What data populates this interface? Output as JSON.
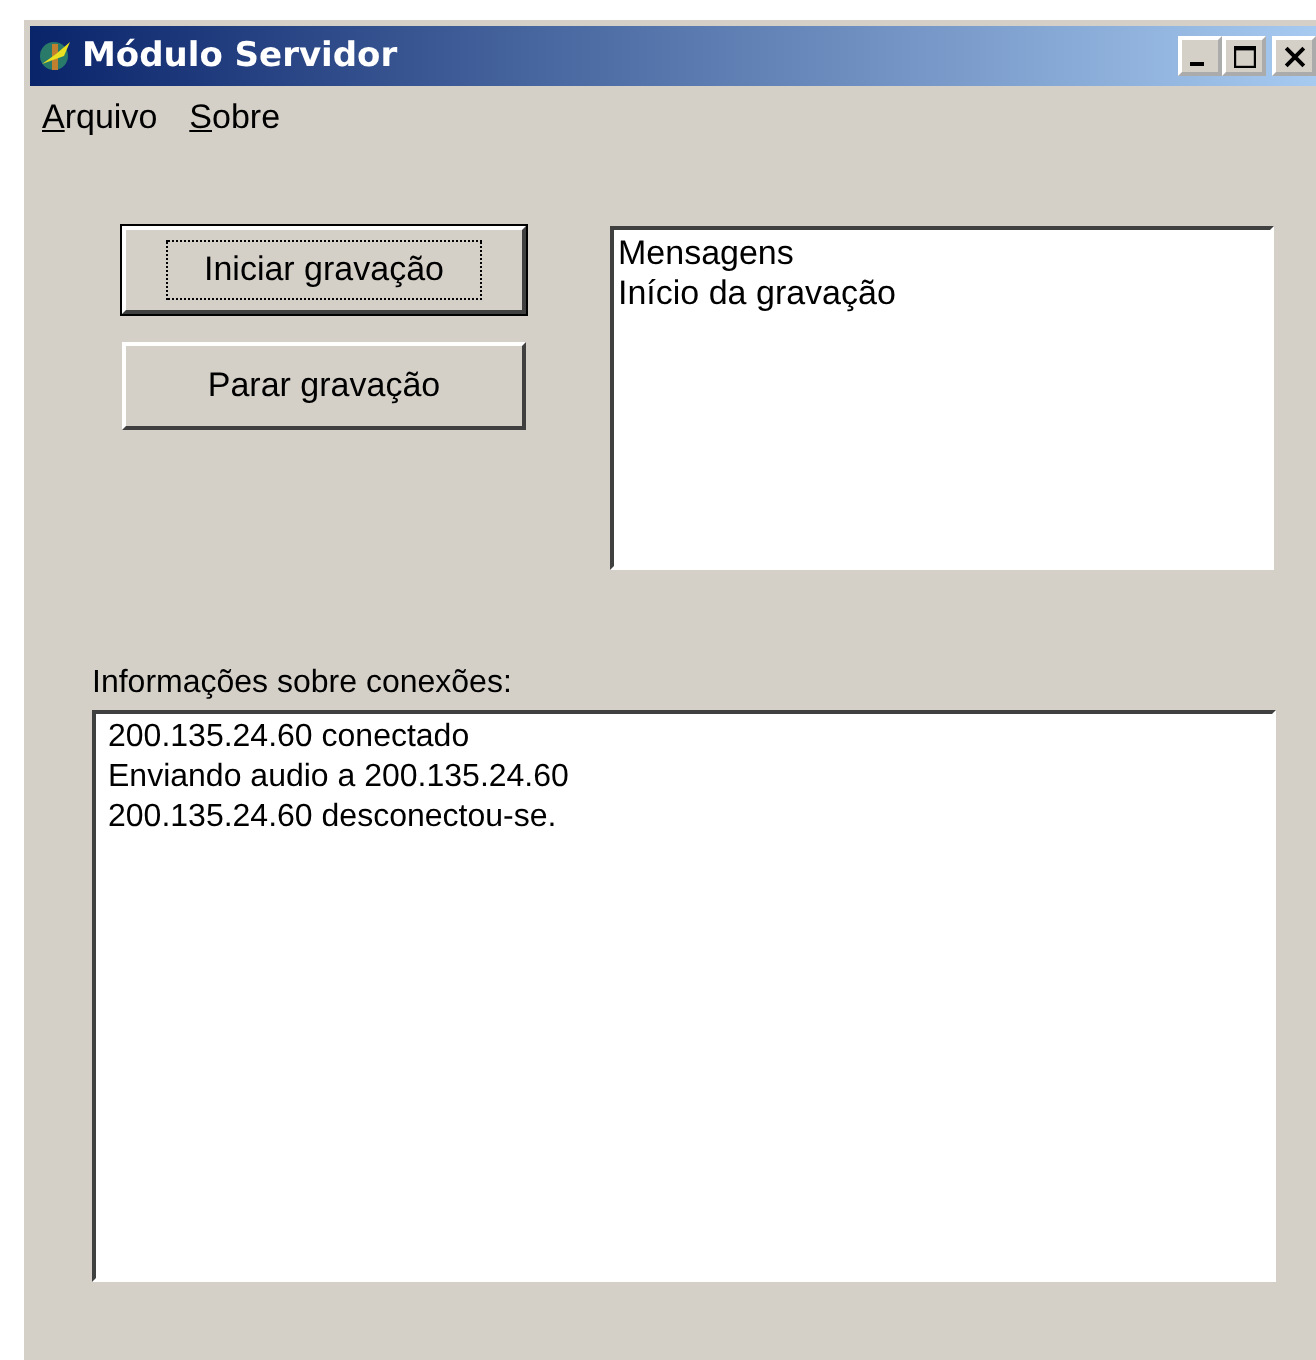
{
  "window": {
    "title": "Módulo Servidor"
  },
  "menu": [
    {
      "label": "Arquivo"
    },
    {
      "label": "Sobre"
    }
  ],
  "buttons": [
    {
      "label": "Iniciar gravação",
      "focused": true
    },
    {
      "label": "Parar gravação",
      "focused": false
    }
  ],
  "messages": {
    "lines": [
      "Mensagens",
      "Início da gravação"
    ]
  },
  "connections": {
    "label": "Informações sobre conexões:",
    "lines": [
      "200.135.24.60 conectado",
      "Enviando audio a 200.135.24.60",
      "200.135.24.60 desconectou-se."
    ]
  }
}
